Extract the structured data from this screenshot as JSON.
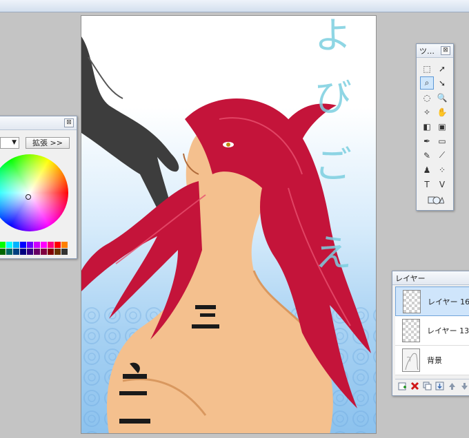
{
  "canvas": {
    "title_chars": [
      "よ",
      "び",
      "ご",
      "え"
    ]
  },
  "color_panel": {
    "close_symbol": "⊠",
    "mode_arrow": "▼",
    "expand_label": "拡張 >>",
    "palette": [
      "#00ff00",
      "#00ffff",
      "#00b3ff",
      "#0000ff",
      "#6600ff",
      "#cc00ff",
      "#ff00ff",
      "#ff0080",
      "#ff0000",
      "#ff8000",
      "#006600",
      "#006666",
      "#004080",
      "#000080",
      "#330080",
      "#660066",
      "#800040",
      "#800000",
      "#663300",
      "#333333"
    ]
  },
  "tool_panel": {
    "title": "ツ…",
    "close_symbol": "⊠",
    "tools": [
      {
        "name": "select-rect-icon",
        "glyph": "⬚"
      },
      {
        "name": "move-arrow-icon",
        "glyph": "➚"
      },
      {
        "name": "lasso-icon",
        "glyph": "⌕"
      },
      {
        "name": "select-arrow-icon",
        "glyph": "➘"
      },
      {
        "name": "ellipse-select-icon",
        "glyph": "◌"
      },
      {
        "name": "zoom-icon",
        "glyph": "🔍"
      },
      {
        "name": "magic-wand-icon",
        "glyph": "✧"
      },
      {
        "name": "hand-icon",
        "glyph": "✋"
      },
      {
        "name": "bucket-icon",
        "glyph": "◧"
      },
      {
        "name": "gradient-icon",
        "glyph": "▣"
      },
      {
        "name": "pen-icon",
        "glyph": "✒"
      },
      {
        "name": "eraser-icon",
        "glyph": "▭"
      },
      {
        "name": "pencil-icon",
        "glyph": "✎"
      },
      {
        "name": "eyedropper-icon",
        "glyph": "⟋"
      },
      {
        "name": "stamp-icon",
        "glyph": "♟"
      },
      {
        "name": "airbrush-icon",
        "glyph": "⁘"
      },
      {
        "name": "text-icon",
        "glyph": "T"
      },
      {
        "name": "vertical-text-icon",
        "glyph": "V"
      }
    ]
  },
  "layer_panel": {
    "title": "レイヤー",
    "layers": [
      {
        "name": "レイヤー 16",
        "selected": true,
        "kind": "transparent"
      },
      {
        "name": "レイヤー 13",
        "selected": false,
        "kind": "transparent"
      },
      {
        "name": "背景",
        "selected": false,
        "kind": "background"
      }
    ],
    "toolbar_icons": [
      "new-layer-icon",
      "delete-layer-icon",
      "duplicate-layer-icon",
      "merge-down-icon",
      "move-up-icon",
      "move-down-icon"
    ]
  }
}
